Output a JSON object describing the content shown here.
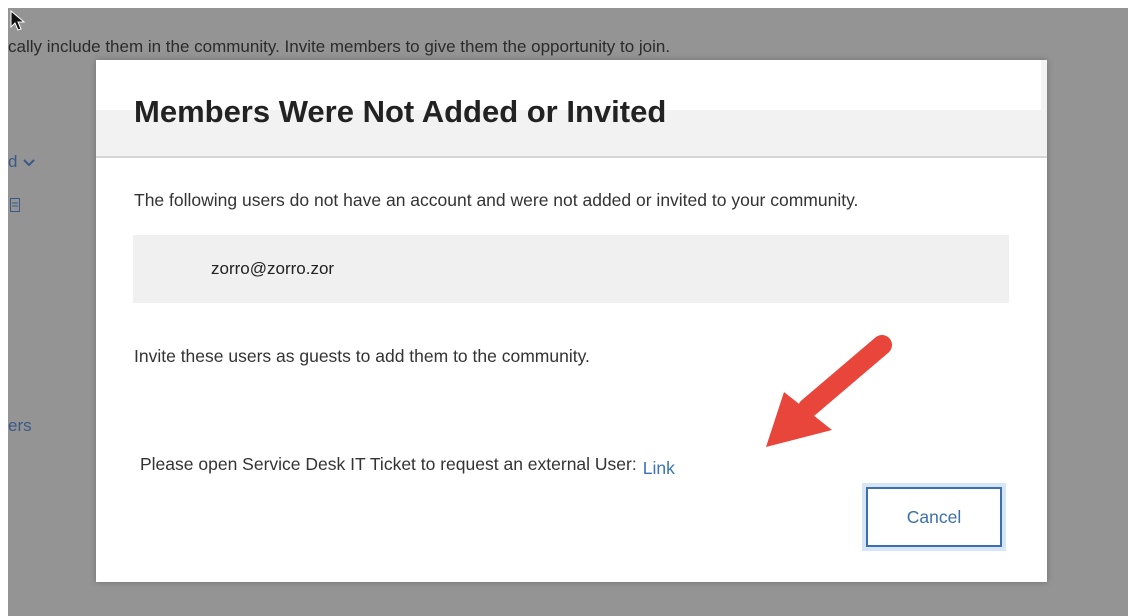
{
  "background": {
    "top_text": "cally include them in the community. Invite members to give them the opportunity to join.",
    "frag_d": "d",
    "frag_ers": "ers"
  },
  "modal": {
    "title": "Members Were Not Added or Invited",
    "description": "The following users do not have an account and were not added or invited to your community.",
    "users": [
      "zorro@zorro.zor"
    ],
    "invite_text": "Invite these users as guests to add them to the community.",
    "ticket_text": "Please open Service Desk IT Ticket to request an external User:",
    "ticket_link": "Link",
    "cancel_label": "Cancel"
  },
  "icons": {
    "cursor": "mouse-pointer-icon",
    "chevron": "chevron-down-icon",
    "doc": "document-icon",
    "annotation": "red-arrow-annotation"
  },
  "colors": {
    "overlay": "#949494",
    "link": "#3b73b9",
    "button_border": "#3b6fb0",
    "annotation_arrow": "#e8463b"
  }
}
